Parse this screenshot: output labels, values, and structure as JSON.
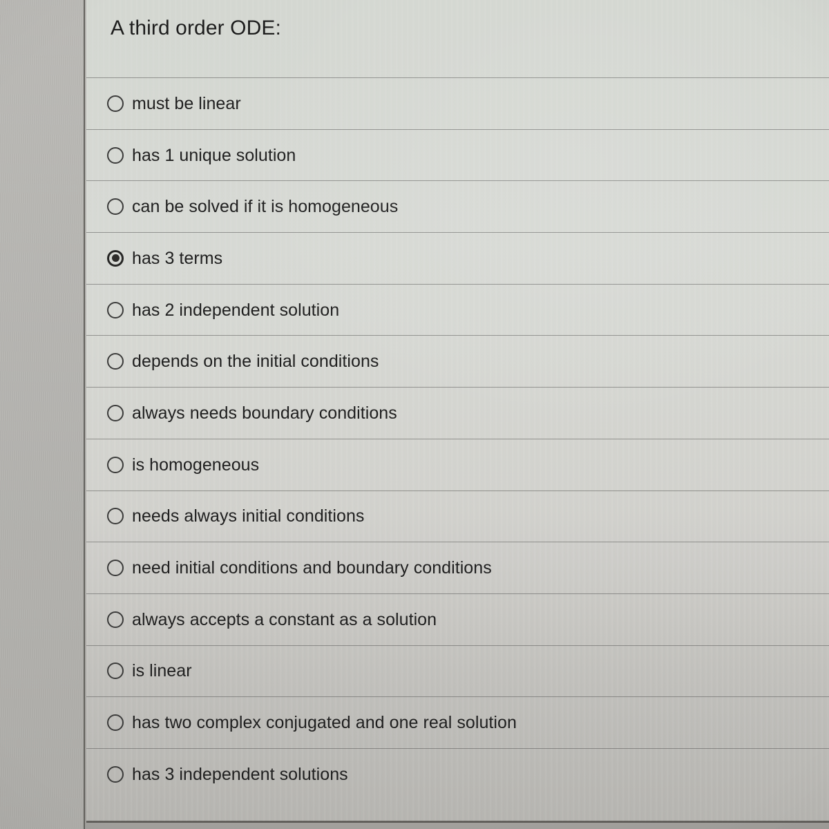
{
  "question": {
    "title": "A third order ODE:"
  },
  "options": [
    {
      "label": "must be linear",
      "selected": false
    },
    {
      "label": "has 1 unique solution",
      "selected": false
    },
    {
      "label": "can be solved if it is homogeneous",
      "selected": false
    },
    {
      "label": "has 3 terms",
      "selected": true
    },
    {
      "label": "has 2 independent solution",
      "selected": false
    },
    {
      "label": "depends on the initial conditions",
      "selected": false
    },
    {
      "label": "always needs boundary conditions",
      "selected": false
    },
    {
      "label": "is homogeneous",
      "selected": false
    },
    {
      "label": "needs always initial conditions",
      "selected": false
    },
    {
      "label": "need initial conditions and boundary conditions",
      "selected": false
    },
    {
      "label": "always accepts a constant as a solution",
      "selected": false
    },
    {
      "label": "is linear",
      "selected": false
    },
    {
      "label": "has two complex conjugated and one real solution",
      "selected": false
    },
    {
      "label": "has 3 independent solutions",
      "selected": false
    }
  ],
  "colors": {
    "text": "#202020",
    "radio_outline": "#3b3b3a",
    "radio_selected_fill": "#2d2c2a",
    "separator": "#5a5a58",
    "screen_background": "#d6d6d2",
    "gutter_background": "#b6b5b1",
    "panel_border": "#55534f"
  }
}
